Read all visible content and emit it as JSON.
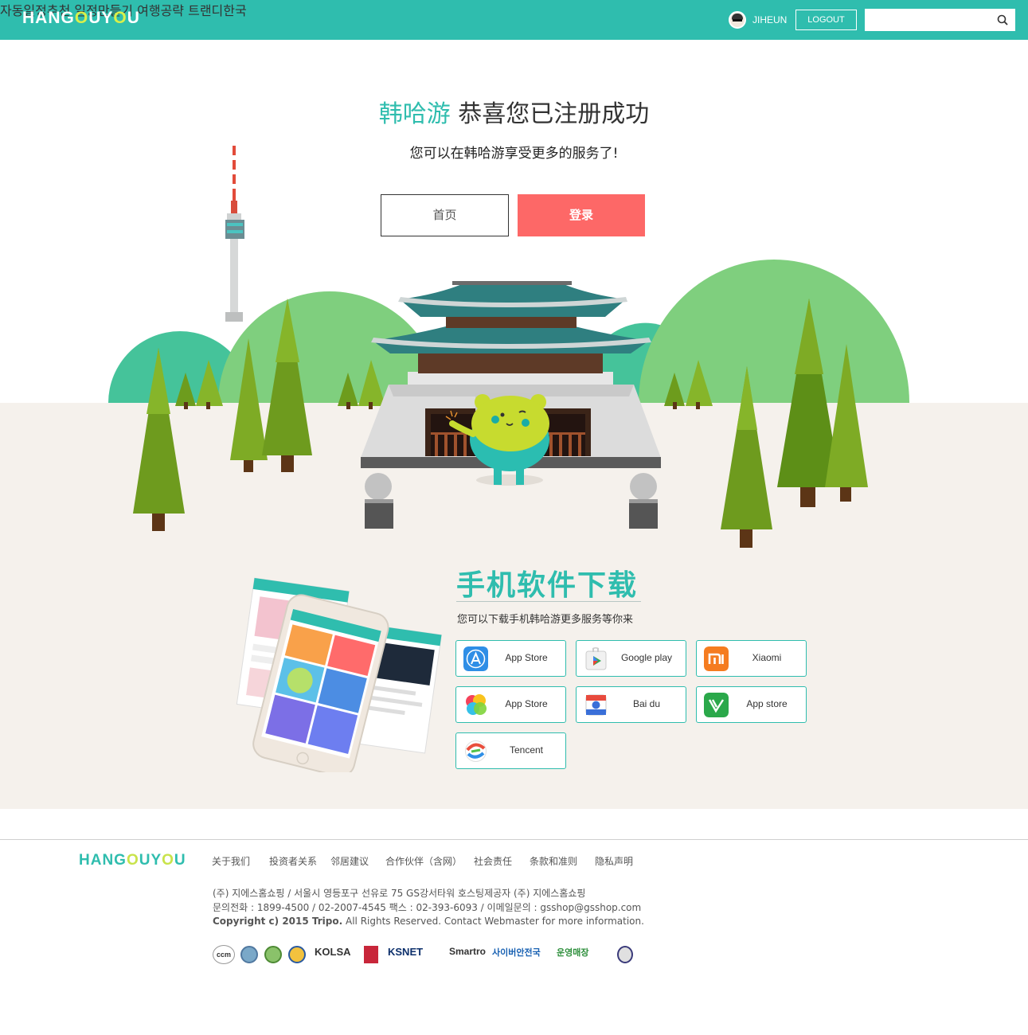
{
  "header": {
    "logo": "HANGOUYOU",
    "nav": [
      "자동일정추천",
      "일정만들기",
      "여행공략",
      "트랜디한국"
    ],
    "username": "JIHEUN",
    "logout_label": "LOGOUT",
    "search_placeholder": ""
  },
  "hero": {
    "brand": "韩哈游",
    "title": "恭喜您已注册成功",
    "subtitle": "您可以在韩哈游享受更多的服务了!",
    "home_button": "首页",
    "login_button": "登录"
  },
  "app_download": {
    "title": "手机软件下载",
    "subtitle": "您可以下载手机韩哈游更多服务等你来",
    "stores": [
      {
        "label": "App Store",
        "icon": "apple-app-store-icon"
      },
      {
        "label": "Google play",
        "icon": "google-play-icon"
      },
      {
        "label": "Xiaomi",
        "icon": "xiaomi-icon"
      },
      {
        "label": "App Store",
        "icon": "game-center-icon"
      },
      {
        "label": "Bai du",
        "icon": "baidu-icon"
      },
      {
        "label": "App store",
        "icon": "wandoujia-icon"
      },
      {
        "label": "Tencent",
        "icon": "tencent-icon"
      }
    ]
  },
  "footer": {
    "logo": "HANGOUYOU",
    "links": [
      "关于我们",
      "投资者关系",
      "邻居建议",
      "合作伙伴（含网）",
      "社会责任",
      "条款和准则",
      "隐私声明"
    ],
    "company_line": "(주) 지에스홈쇼핑  / 서울시 영등포구 선유로 75 GS강서타워 호스팅제공자 (주) 지에스홈쇼핑",
    "contact_line": "문의전화 : 1899-4500 / 02-2007-4545 팩스 : 02-393-6093 / 이메일문의 : gsshop@gsshop.com",
    "copyright_bold": "Copyright c) 2015 Tripo.",
    "copyright_rest": " All Rights Reserved. Contact Webmaster for more information.",
    "badges": [
      "ccm",
      "KOLSA",
      "KSNET",
      "Smartro",
      "사이버안전국",
      "운영매장"
    ]
  },
  "colors": {
    "brand_teal": "#2fbdae",
    "login_red": "#fd6867",
    "beige": "#f5f1ec",
    "hill_green": "#7fcf7e"
  }
}
